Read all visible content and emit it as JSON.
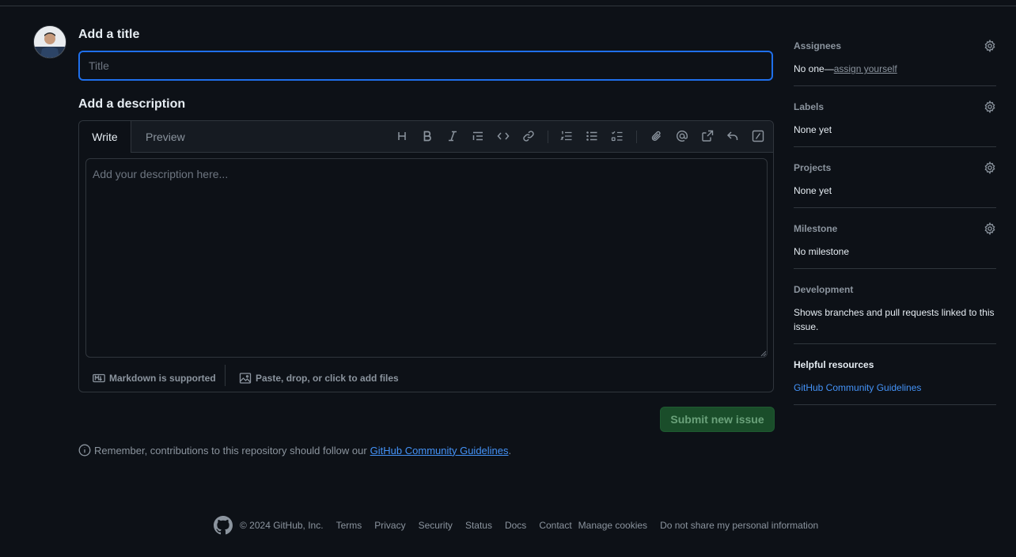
{
  "form": {
    "title_heading": "Add a title",
    "title_placeholder": "Title",
    "description_heading": "Add a description",
    "tabs": [
      "Write",
      "Preview"
    ],
    "description_placeholder": "Add your description here...",
    "markdown_label": "Markdown is supported",
    "attach_label": "Paste, drop, or click to add files",
    "submit_label": "Submit new issue",
    "notice_text": "Remember, contributions to this repository should follow our",
    "notice_link": "GitHub Community Guidelines",
    "notice_end": "."
  },
  "toolbar_icons": [
    "heading-icon",
    "bold-icon",
    "italic-icon",
    "quote-icon",
    "code-icon",
    "link-icon",
    "ordered-list-icon",
    "unordered-list-icon",
    "task-list-icon",
    "attach-icon",
    "mention-icon",
    "reference-icon",
    "reply-icon",
    "slash-icon"
  ],
  "sidebar": {
    "assignees": {
      "label": "Assignees",
      "value_prefix": "No one—",
      "value_link": "assign yourself"
    },
    "labels": {
      "label": "Labels",
      "value": "None yet"
    },
    "projects": {
      "label": "Projects",
      "value": "None yet"
    },
    "milestone": {
      "label": "Milestone",
      "value": "No milestone"
    },
    "development": {
      "label": "Development",
      "value": "Shows branches and pull requests linked to this issue."
    },
    "resources": {
      "label": "Helpful resources",
      "link": "GitHub Community Guidelines"
    }
  },
  "footer": {
    "copyright": "© 2024 GitHub, Inc.",
    "links": [
      "Terms",
      "Privacy",
      "Security",
      "Status",
      "Docs",
      "Contact",
      "Manage cookies",
      "Do not share my personal information"
    ]
  },
  "colors": {
    "background": "#0d1117",
    "accent": "#1f6feb",
    "link": "#4493f8",
    "submit_bg": "#1a4d2a"
  }
}
